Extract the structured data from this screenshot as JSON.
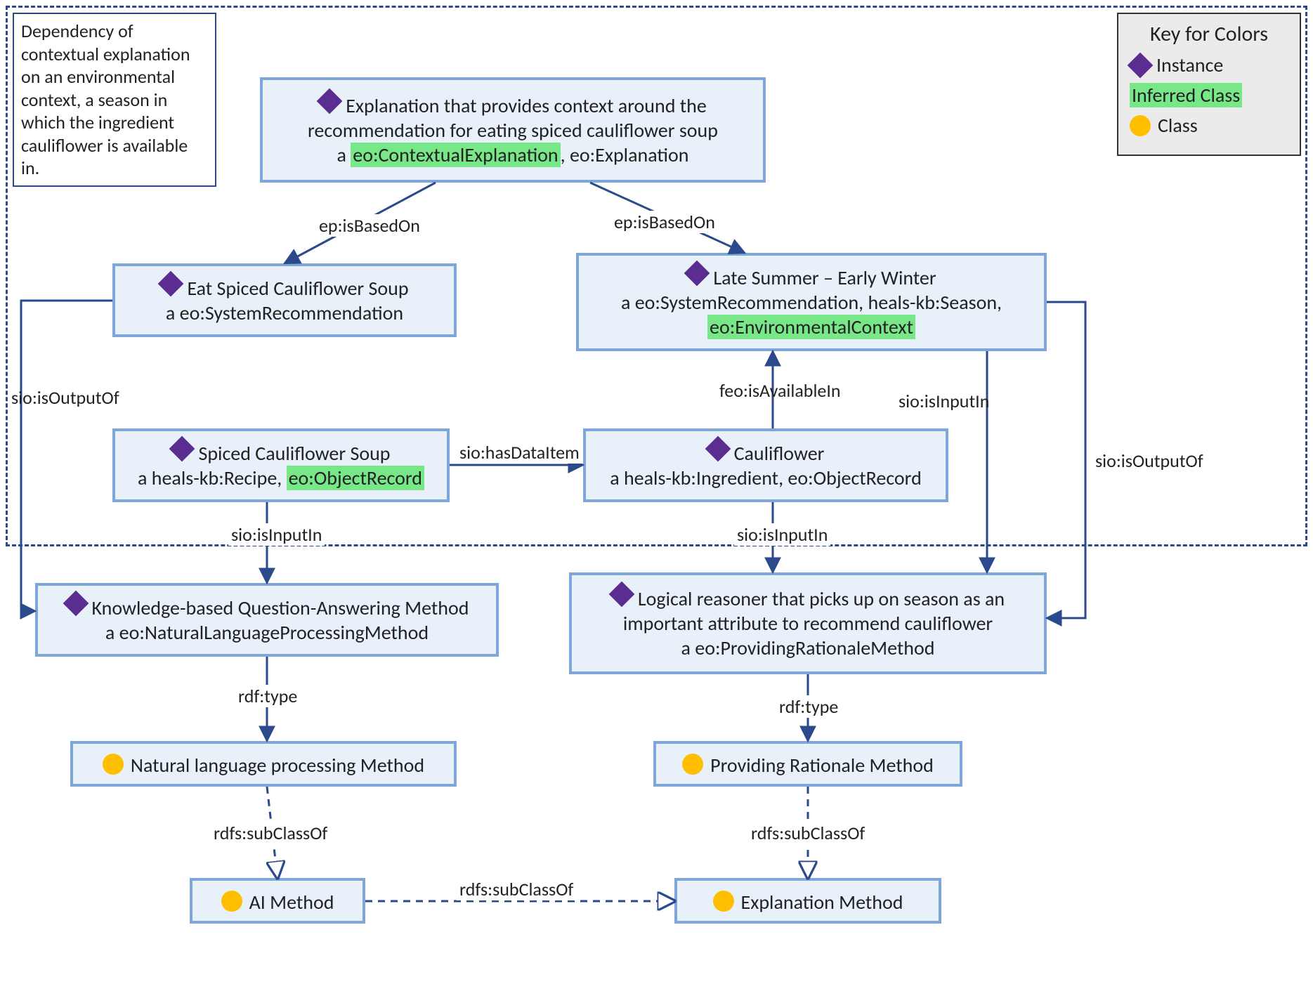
{
  "note": "Dependency of contextual explanation on an environmental context, a season in which the ingredient cauliflower is available in.",
  "legend": {
    "title": "Key for Colors",
    "instance": "Instance",
    "inferred": "Inferred Class",
    "class": "Class"
  },
  "nodes": {
    "n1_line1": "Explanation that provides context around the",
    "n1_line2": "recommendation for eating spiced cauliflower soup",
    "n1_line3a": "a ",
    "n1_line3b_inferred": "eo:ContextualExplanation",
    "n1_line3c": ", eo:Explanation",
    "n2_line1": "Eat Spiced Cauliflower Soup",
    "n2_line2": "a eo:SystemRecommendation",
    "n3_line1": "Late Summer – Early Winter",
    "n3_line2": "a eo:SystemRecommendation, heals-kb:Season,",
    "n3_line3_inferred": "eo:EnvironmentalContext",
    "n4_line1": "Spiced Cauliflower Soup",
    "n4_line2a": "a heals-kb:Recipe, ",
    "n4_line2b_inferred": "eo:ObjectRecord",
    "n5_line1": "Cauliflower",
    "n5_line2": "a heals-kb:Ingredient, eo:ObjectRecord",
    "n6_line1": "Knowledge-based Question-Answering Method",
    "n6_line2": "a eo:NaturalLanguageProcessingMethod",
    "n7_line1": "Logical reasoner that picks up on season as an",
    "n7_line2": "important attribute to recommend cauliflower",
    "n7_line3": "a eo:ProvidingRationaleMethod",
    "n8": "Natural language processing Method",
    "n9": "Providing Rationale Method",
    "n10": "AI Method",
    "n11": "Explanation Method"
  },
  "edges": {
    "isBasedOn": "ep:isBasedOn",
    "isOutputOf": "sio:isOutputOf",
    "hasDataItem": "sio:hasDataItem",
    "isInputIn": "sio:isInputIn",
    "isAvailableIn": "feo:isAvailableIn",
    "rdfType": "rdf:type",
    "subClassOf": "rdfs:subClassOf"
  }
}
